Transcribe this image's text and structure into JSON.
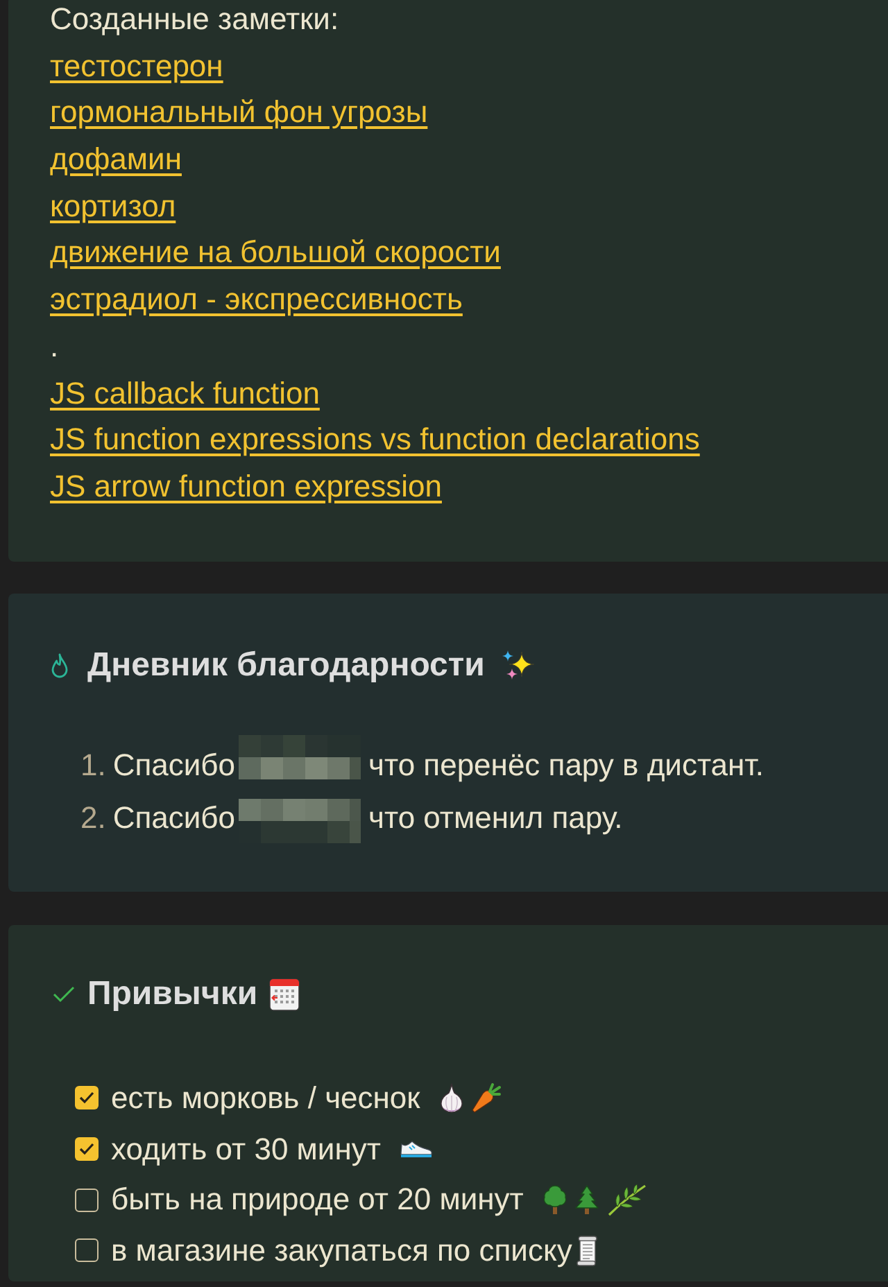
{
  "notes": {
    "heading": "Созданные заметки:",
    "lines": [
      {
        "kind": "link",
        "label": "тестостерон"
      },
      {
        "kind": "link",
        "label": "гормональный фон угрозы"
      },
      {
        "kind": "link",
        "label": "дофамин"
      },
      {
        "kind": "link",
        "label": "кортизол"
      },
      {
        "kind": "link",
        "label": "движение на большой скорости"
      },
      {
        "kind": "link",
        "label": "эстрадиол - экспрессивность"
      },
      {
        "kind": "text",
        "label": "."
      },
      {
        "kind": "link",
        "label": "JS callback function"
      },
      {
        "kind": "link",
        "label": "JS function expressions vs function declarations"
      },
      {
        "kind": "link",
        "label": "JS arrow function expression"
      }
    ]
  },
  "gratitude": {
    "title": "Дневник благодарности",
    "items": [
      {
        "number": "1.",
        "before": "Спасибо",
        "after": "что перенёс пару в дистант."
      },
      {
        "number": "2.",
        "before": "Спасибо",
        "after": "что отменил пару."
      }
    ]
  },
  "habits": {
    "title": "Привычки",
    "items": [
      {
        "label": "есть морковь / чеснок",
        "checked": true
      },
      {
        "label": "ходить от 30 минут",
        "checked": true
      },
      {
        "label": "быть на природе от 20 минут",
        "checked": false
      },
      {
        "label": "в магазине закупаться по списку",
        "checked": false
      }
    ]
  }
}
